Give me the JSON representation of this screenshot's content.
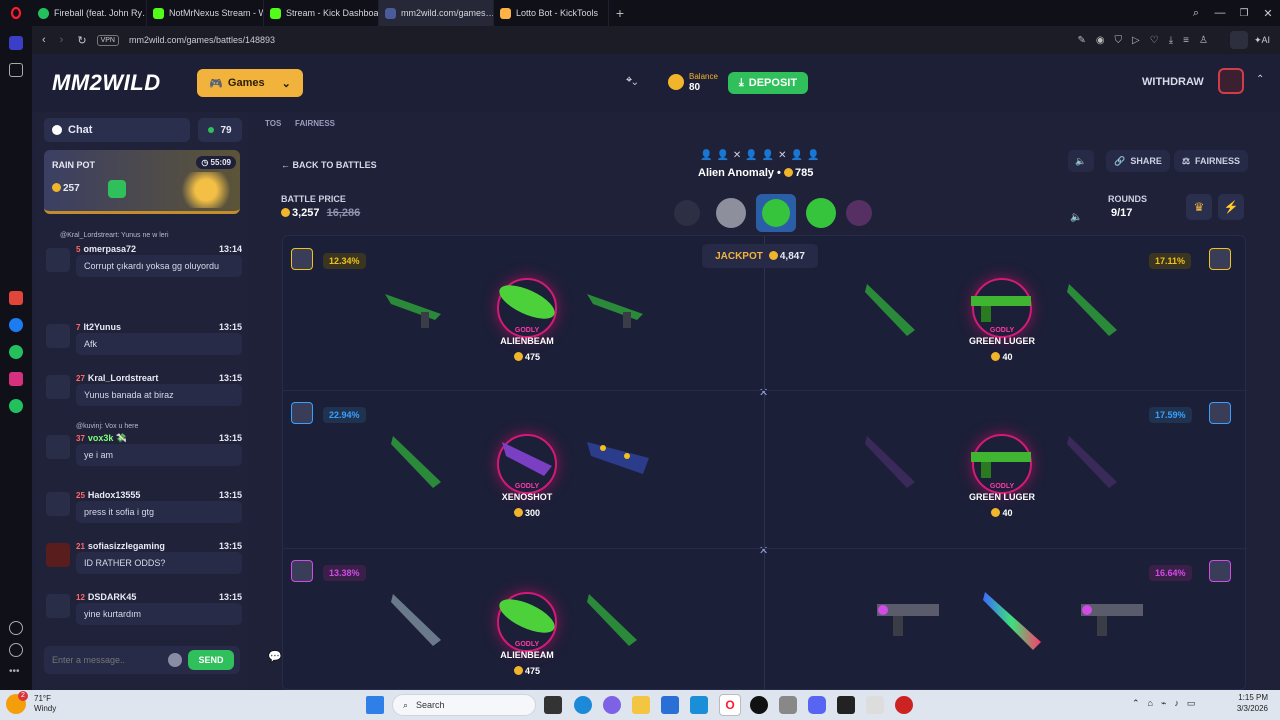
{
  "browser": {
    "tabs": [
      {
        "label": "Fireball (feat. John Ry…",
        "color": "#22c15e"
      },
      {
        "label": "NotMrNexus Stream - Wa…",
        "color": "#53fc18"
      },
      {
        "label": "Stream - Kick Dashboard",
        "color": "#53fc18"
      },
      {
        "label": "mm2wild.com/games…",
        "color": "#8aa0ff"
      },
      {
        "label": "Lotto Bot - KickTools",
        "color": "#ffb347"
      }
    ],
    "new_tab": "+",
    "vpn": "VPN",
    "url": "mm2wild.com/games/battles/148893",
    "ai_label": "AI"
  },
  "header": {
    "logo": "MM2WILD",
    "games_label": "Games",
    "balance_label": "Balance",
    "balance_value": "80",
    "deposit_label": "DEPOSIT",
    "withdraw_label": "WITHDRAW",
    "avatar_badge": "14"
  },
  "chat": {
    "title": "Chat",
    "online": "79",
    "rain_title": "RAIN POT",
    "rain_timer": "55:09",
    "rain_amount": "257",
    "messages": [
      {
        "reply": "@Kral_Lordstreart: Yunus ne w leri",
        "level": "5",
        "name": "omerpasa72",
        "time": "13:14",
        "text": "Corrupt çıkardı yoksa gg oluyordu"
      },
      {
        "reply": "",
        "level": "7",
        "name": "It2Yunus",
        "time": "13:15",
        "text": "Afk"
      },
      {
        "reply": "",
        "level": "27",
        "name": "Kral_Lordstreart",
        "time": "13:15",
        "text": "Yunus banada at biraz"
      },
      {
        "reply": "@kuvinj: Vox u here",
        "level": "37",
        "name": "vox3k 💸",
        "time": "13:15",
        "text": "ye i am"
      },
      {
        "reply": "",
        "level": "25",
        "name": "Hadox13555",
        "time": "13:15",
        "text": "press it sofia i gtg"
      },
      {
        "reply": "",
        "level": "21",
        "name": "sofiasizzlegaming",
        "time": "13:15",
        "text": "ID RATHER ODDS?"
      },
      {
        "reply": "",
        "level": "12",
        "name": "DSDARK45",
        "time": "13:15",
        "text": "yine kurtardım"
      }
    ],
    "input_placeholder": "Enter a message..",
    "send_label": "SEND"
  },
  "nav": {
    "tos": "TOS",
    "fairness": "FAIRNESS"
  },
  "battle": {
    "back_label": "BACK TO BATTLES",
    "price_label": "BATTLE PRICE",
    "price_value": "3,257",
    "price_old": "16,286",
    "case_name": "Alien Anomaly",
    "case_value": "785",
    "share_label": "SHARE",
    "fairness_label": "FAIRNESS",
    "rounds_label": "ROUNDS",
    "rounds_value": "9/17",
    "jackpot_label": "JACKPOT",
    "jackpot_value": "4,847",
    "rows": [
      {
        "left_pct": "12.34%",
        "right_pct": "17.11%",
        "left_color": "#f2c21b",
        "right_color": "#f2c21b",
        "left_item": {
          "rarity": "GODLY",
          "name": "ALIENBEAM",
          "value": "475"
        },
        "right_item": {
          "rarity": "GODLY",
          "name": "GREEN LUGER",
          "value": "40"
        }
      },
      {
        "left_pct": "22.94%",
        "right_pct": "17.59%",
        "left_color": "#3aa0ff",
        "right_color": "#3aa0ff",
        "left_item": {
          "rarity": "GODLY",
          "name": "XENOSHOT",
          "value": "300"
        },
        "right_item": {
          "rarity": "GODLY",
          "name": "GREEN LUGER",
          "value": "40"
        }
      },
      {
        "left_pct": "13.38%",
        "right_pct": "16.64%",
        "left_color": "#d24be6",
        "right_color": "#d24be6",
        "left_item": {
          "rarity": "GODLY",
          "name": "ALIENBEAM",
          "value": "475"
        },
        "right_item": {
          "rarity": "",
          "name": "",
          "value": ""
        }
      }
    ]
  },
  "taskbar": {
    "weather_temp": "71°F",
    "weather_desc": "Windy",
    "search_label": "Search",
    "time": "1:15 PM",
    "date": "3/3/2026",
    "notif": "2"
  }
}
